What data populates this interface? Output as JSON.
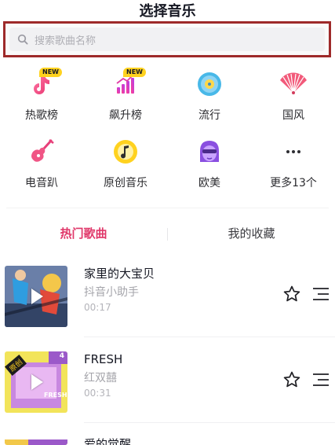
{
  "header": {
    "title": "选择音乐"
  },
  "search": {
    "placeholder": "搜索歌曲名称"
  },
  "categories": [
    {
      "label": "热歌榜",
      "icon": "tiktok-note-icon",
      "badge": "NEW"
    },
    {
      "label": "飙升榜",
      "icon": "rising-chart-icon",
      "badge": "NEW"
    },
    {
      "label": "流行",
      "icon": "vinyl-disc-icon"
    },
    {
      "label": "国风",
      "icon": "folding-fan-icon"
    },
    {
      "label": "电音趴",
      "icon": "electric-guitar-icon"
    },
    {
      "label": "原创音乐",
      "icon": "original-music-icon"
    },
    {
      "label": "欧美",
      "icon": "masked-face-icon"
    },
    {
      "label": "更多13个",
      "icon": "more-dots-icon"
    }
  ],
  "tabs": [
    {
      "label": "热门歌曲",
      "active": true
    },
    {
      "label": "我的收藏",
      "active": false
    }
  ],
  "songs": [
    {
      "title": "家里的大宝贝",
      "artist": "抖音小助手",
      "duration": "00:17"
    },
    {
      "title": "FRESH",
      "artist": "红双囍",
      "duration": "00:31",
      "cover_badge": "原创",
      "cover_count": "4"
    },
    {
      "title": "爱的觉醒",
      "artist": "",
      "duration": ""
    }
  ],
  "colors": {
    "accent": "#e0386a",
    "search_highlight_border": "#9e2a2a",
    "badge_yellow": "#ffd21f"
  }
}
